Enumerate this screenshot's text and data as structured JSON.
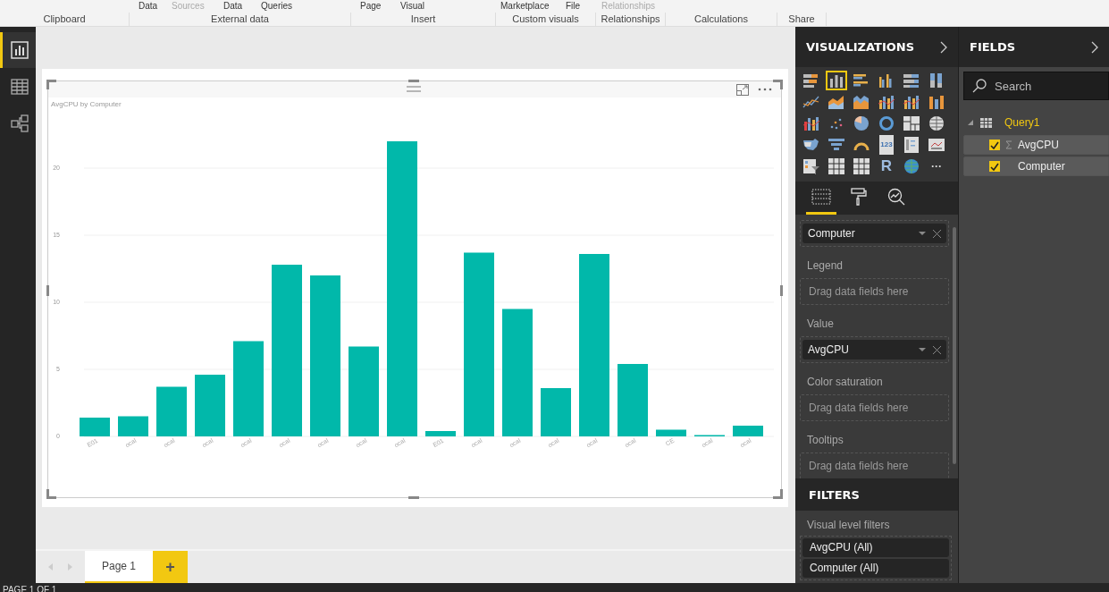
{
  "ribbon": {
    "top_items": [
      {
        "label": "Data",
        "disabled": false
      },
      {
        "label": "Sources",
        "disabled": true
      },
      {
        "label": "Data",
        "disabled": false
      },
      {
        "label": "Queries",
        "disabled": false
      },
      {
        "label": "Page",
        "disabled": false
      },
      {
        "label": "Visual",
        "disabled": false
      },
      {
        "label": "Marketplace",
        "disabled": false
      },
      {
        "label": "File",
        "disabled": false
      },
      {
        "label": "Relationships",
        "disabled": true
      }
    ],
    "groups": [
      "Clipboard",
      "External data",
      "Insert",
      "Custom visuals",
      "Relationships",
      "Calculations",
      "Share"
    ]
  },
  "left_rail": [
    {
      "kind": "report",
      "selected": true
    },
    {
      "kind": "data",
      "selected": false
    },
    {
      "kind": "relationships",
      "selected": false
    }
  ],
  "visual": {
    "chart_data": {
      "type": "bar",
      "title": "AvgCPU by Computer",
      "categories": [
        "E01",
        "ocal",
        "ocal",
        "ocal",
        "ocal",
        "ocal",
        "ocal",
        "ocal",
        "ocal",
        "E01",
        "ocal",
        "ocal",
        "ocal",
        "ocal",
        "ocal",
        "CE",
        "ocal",
        "ocal"
      ],
      "values": [
        1.4,
        1.5,
        3.7,
        4.6,
        7.1,
        12.8,
        12.0,
        6.7,
        22.0,
        0.4,
        13.7,
        9.5,
        3.6,
        13.6,
        5.4,
        0.5,
        0.1,
        0.8
      ],
      "ylim": [
        0,
        22
      ],
      "yticks": [
        0,
        5,
        10,
        15,
        20
      ],
      "grid": true
    }
  },
  "page_tabs": [
    {
      "label": "Page 1",
      "selected": true
    }
  ],
  "add_page": "+",
  "status_bar": "PAGE 1 OF 1",
  "visualizations": {
    "title": "VISUALIZATIONS",
    "icons": [
      {
        "kind": "stacked-bar",
        "selected": false
      },
      {
        "kind": "stacked-column",
        "selected": true
      },
      {
        "kind": "clustered-bar",
        "selected": false
      },
      {
        "kind": "clustered-column",
        "selected": false
      },
      {
        "kind": "stacked-bar-100",
        "selected": false
      },
      {
        "kind": "stacked-column-100",
        "selected": false
      },
      {
        "kind": "line",
        "selected": false
      },
      {
        "kind": "area",
        "selected": false
      },
      {
        "kind": "stacked-area",
        "selected": false
      },
      {
        "kind": "line-column",
        "selected": false
      },
      {
        "kind": "line-clustered",
        "selected": false
      },
      {
        "kind": "ribbon",
        "selected": false
      },
      {
        "kind": "waterfall",
        "selected": false
      },
      {
        "kind": "scatter",
        "selected": false
      },
      {
        "kind": "pie",
        "selected": false
      },
      {
        "kind": "donut",
        "selected": false
      },
      {
        "kind": "treemap",
        "selected": false
      },
      {
        "kind": "map",
        "selected": false
      },
      {
        "kind": "filled-map",
        "selected": false
      },
      {
        "kind": "funnel",
        "selected": false
      },
      {
        "kind": "gauge",
        "selected": false
      },
      {
        "kind": "card",
        "selected": false,
        "label": "123"
      },
      {
        "kind": "multi-row-card",
        "selected": false
      },
      {
        "kind": "kpi",
        "selected": false
      },
      {
        "kind": "slicer",
        "selected": false
      },
      {
        "kind": "table",
        "selected": false
      },
      {
        "kind": "matrix",
        "selected": false
      },
      {
        "kind": "r-script",
        "selected": false,
        "label": "R"
      },
      {
        "kind": "globe",
        "selected": false
      },
      {
        "kind": "more",
        "selected": false,
        "label": "···"
      }
    ],
    "tabs": [
      {
        "kind": "fields",
        "selected": true
      },
      {
        "kind": "format",
        "selected": false
      },
      {
        "kind": "analytics",
        "selected": false
      }
    ],
    "wells": [
      {
        "field": "Computer"
      },
      {
        "label": "Legend",
        "placeholder": "Drag data fields here"
      },
      {
        "label": "Value",
        "field": "AvgCPU"
      },
      {
        "label": "Color saturation",
        "placeholder": "Drag data fields here"
      },
      {
        "label": "Tooltips",
        "placeholder": "Drag data fields here"
      }
    ]
  },
  "filters": {
    "title": "FILTERS",
    "section": "Visual level filters",
    "items": [
      "AvgCPU  (All)",
      "Computer  (All)"
    ]
  },
  "fields": {
    "title": "FIELDS",
    "search": {
      "placeholder": "Search"
    },
    "tables": [
      {
        "name": "Query1",
        "expanded": true,
        "children": [
          {
            "name": "AvgCPU",
            "checked": true,
            "kind": "measure"
          },
          {
            "name": "Computer",
            "checked": true,
            "kind": "column"
          }
        ]
      }
    ]
  }
}
